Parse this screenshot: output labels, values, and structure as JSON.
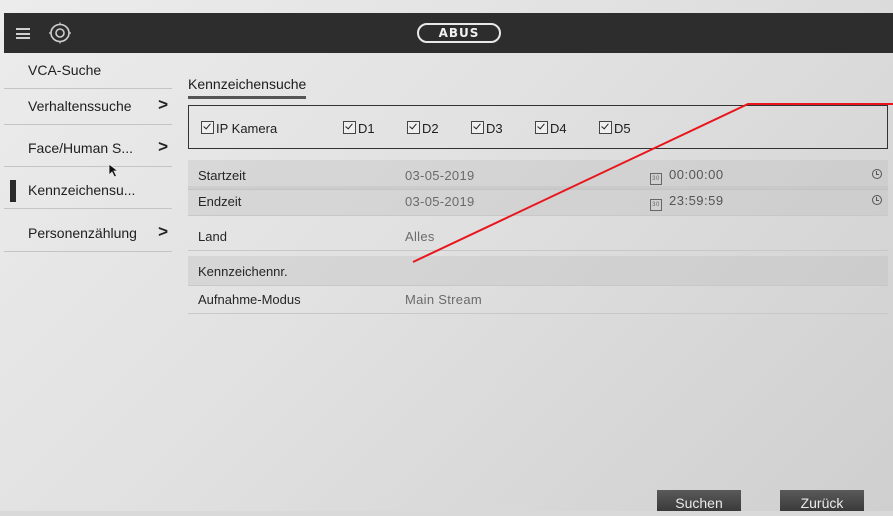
{
  "header": {
    "logo_text": "ABUS",
    "menu_icon": "hamburger-menu-icon",
    "view_icon": "eye-icon"
  },
  "sidebar": {
    "items": [
      {
        "label": "VCA-Suche",
        "chevron": ""
      },
      {
        "label": "Verhaltenssuche",
        "chevron": ">"
      },
      {
        "label": "Face/Human S...",
        "chevron": ">"
      },
      {
        "label": "Kennzeichensu...",
        "chevron": "",
        "selected": true
      },
      {
        "label": "Personenzählung",
        "chevron": ">"
      }
    ]
  },
  "main": {
    "tab_label": "Kennzeichensuche",
    "cameras": {
      "all_label": "IP Kamera",
      "channels": [
        "D1",
        "D2",
        "D3",
        "D4",
        "D5"
      ]
    },
    "fields": {
      "start_label": "Startzeit",
      "start_date": "03-05-2019",
      "start_time": "00:00:00",
      "end_label": "Endzeit",
      "end_date": "03-05-2019",
      "end_time": "23:59:59",
      "country_label": "Land",
      "country_value": "Alles",
      "plate_label": "Kennzeichennr.",
      "plate_value": "",
      "mode_label": "Aufnahme-Modus",
      "mode_value": "Main Stream"
    },
    "buttons": {
      "search": "Suchen",
      "back": "Zurück"
    },
    "calendar_icon_text": "30"
  },
  "colors": {
    "topbar": "#2d2d2d",
    "annotation_line": "#e8161c"
  }
}
